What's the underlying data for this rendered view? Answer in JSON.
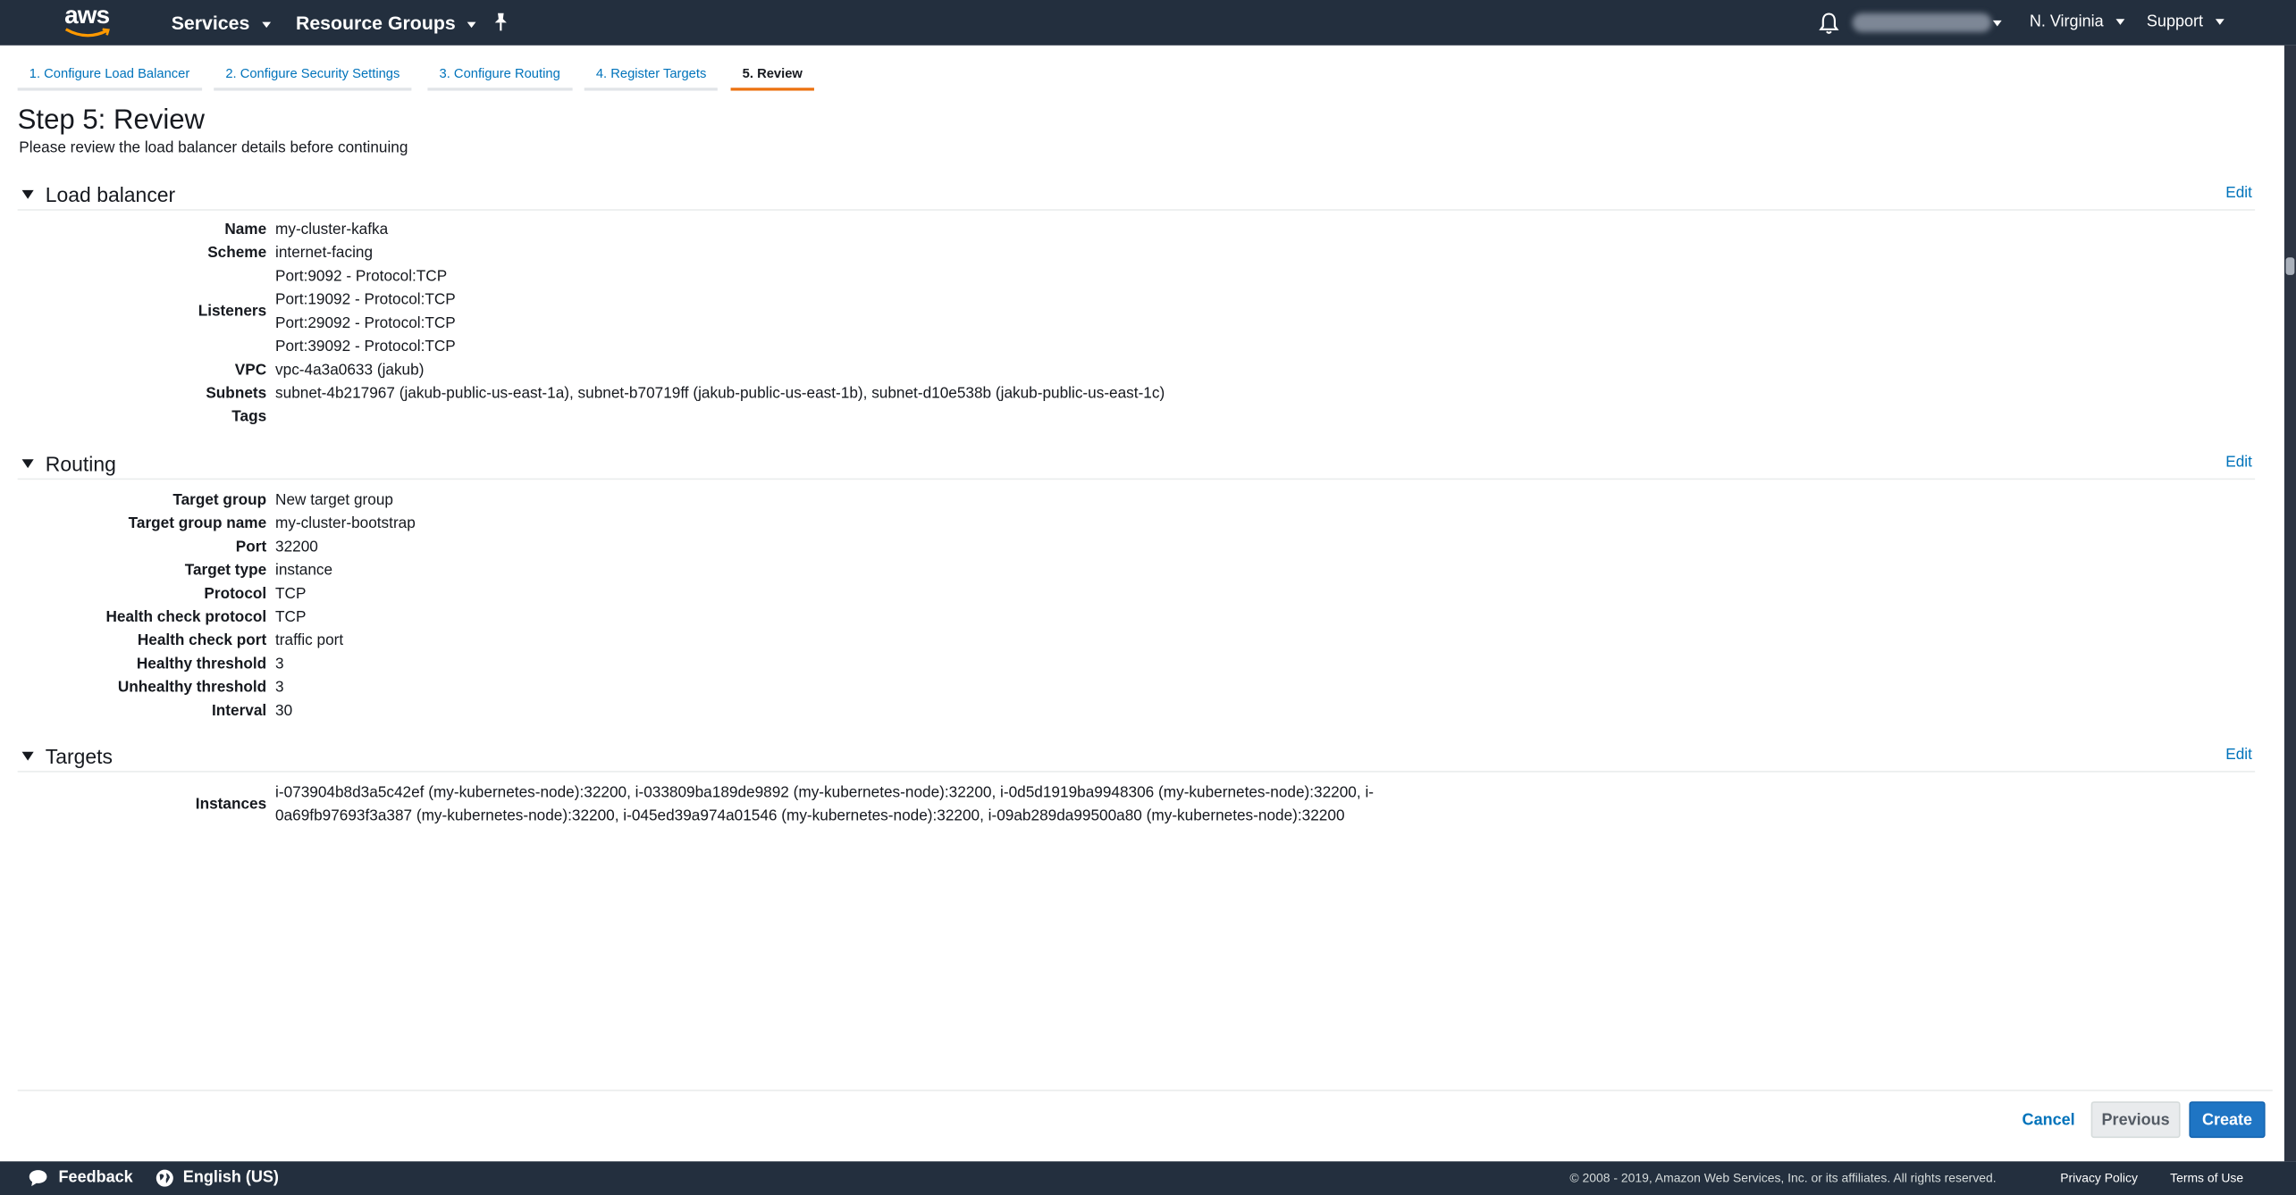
{
  "nav": {
    "logo": "aws",
    "services": "Services",
    "resource_groups": "Resource Groups",
    "region": "N. Virginia",
    "support": "Support"
  },
  "tabs": [
    {
      "label": "1. Configure Load Balancer"
    },
    {
      "label": "2. Configure Security Settings"
    },
    {
      "label": "3. Configure Routing"
    },
    {
      "label": "4. Register Targets"
    },
    {
      "label": "5. Review"
    }
  ],
  "page": {
    "title": "Step 5: Review",
    "subtitle": "Please review the load balancer details before continuing"
  },
  "edit_label": "Edit",
  "load_balancer": {
    "heading": "Load balancer",
    "name_label": "Name",
    "name": "my-cluster-kafka",
    "scheme_label": "Scheme",
    "scheme": "internet-facing",
    "listeners_label": "Listeners",
    "listeners": [
      "Port:9092 - Protocol:TCP",
      "Port:19092 - Protocol:TCP",
      "Port:29092 - Protocol:TCP",
      "Port:39092 - Protocol:TCP"
    ],
    "vpc_label": "VPC",
    "vpc": "vpc-4a3a0633 (jakub)",
    "subnets_label": "Subnets",
    "subnets": "subnet-4b217967 (jakub-public-us-east-1a), subnet-b70719ff (jakub-public-us-east-1b), subnet-d10e538b (jakub-public-us-east-1c)",
    "tags_label": "Tags",
    "tags": ""
  },
  "routing": {
    "heading": "Routing",
    "rows": [
      {
        "label": "Target group",
        "value": "New target group"
      },
      {
        "label": "Target group name",
        "value": "my-cluster-bootstrap"
      },
      {
        "label": "Port",
        "value": "32200"
      },
      {
        "label": "Target type",
        "value": "instance"
      },
      {
        "label": "Protocol",
        "value": "TCP"
      },
      {
        "label": "Health check protocol",
        "value": "TCP"
      },
      {
        "label": "Health check port",
        "value": "traffic port"
      },
      {
        "label": "Healthy threshold",
        "value": "3"
      },
      {
        "label": "Unhealthy threshold",
        "value": "3"
      },
      {
        "label": "Interval",
        "value": "30"
      }
    ]
  },
  "targets": {
    "heading": "Targets",
    "instances_label": "Instances",
    "instances_line1": "i-073904b8d3a5c42ef (my-kubernetes-node):32200, i-033809ba189de9892 (my-kubernetes-node):32200, i-0d5d1919ba9948306 (my-kubernetes-node):32200, i-",
    "instances_line2": "0a69fb97693f3a387 (my-kubernetes-node):32200, i-045ed39a974a01546 (my-kubernetes-node):32200, i-09ab289da99500a80 (my-kubernetes-node):32200"
  },
  "actions": {
    "cancel": "Cancel",
    "previous": "Previous",
    "create": "Create"
  },
  "footer": {
    "feedback": "Feedback",
    "language": "English (US)",
    "copyright": "© 2008 - 2019, Amazon Web Services, Inc. or its affiliates. All rights reserved.",
    "privacy": "Privacy Policy",
    "terms": "Terms of Use"
  },
  "colors": {
    "nav_bg": "#232f3e",
    "link": "#0073bb",
    "active_tab": "#ec7211",
    "primary_button": "#1f75c4"
  }
}
